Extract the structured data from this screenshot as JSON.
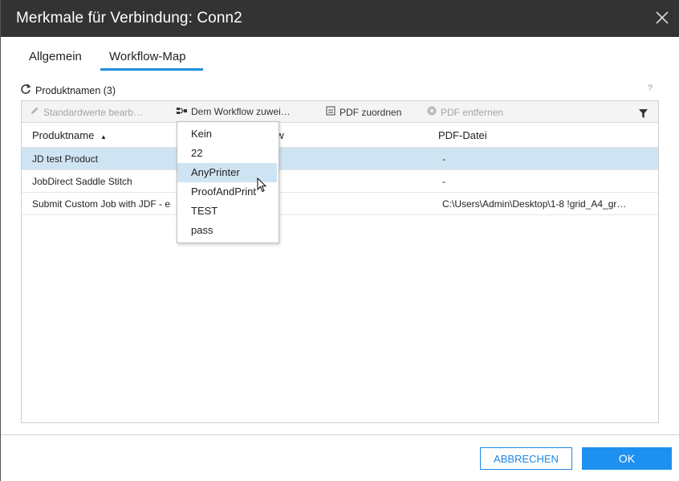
{
  "dialog": {
    "title": "Merkmale für Verbindung: Conn2",
    "close_icon": "close-icon"
  },
  "tabs": [
    {
      "label": "Allgemein",
      "active": false
    },
    {
      "label": "Workflow-Map",
      "active": true
    }
  ],
  "section": {
    "title": "Produktnamen (3)",
    "refresh_icon": "refresh-icon",
    "help": "?"
  },
  "toolbar": {
    "edit_defaults": "Standardwerte bearb…",
    "assign_workflow": "Dem Workflow zuwei…",
    "assign_pdf": "PDF zuordnen",
    "remove_pdf": "PDF entfernen",
    "filter_icon": "filter-icon"
  },
  "table": {
    "columns": [
      "Produktname",
      "Workflow",
      "PDF-Datei"
    ],
    "sort_indicator": "▲",
    "rows": [
      {
        "product": "JD test Product",
        "workflow": "",
        "pdf": "-",
        "selected": true
      },
      {
        "product": "JobDirect Saddle Stitch",
        "workflow": "",
        "pdf": "-",
        "selected": false
      },
      {
        "product": "Submit Custom Job with JDF - e",
        "workflow": "",
        "pdf": "C:\\Users\\Admin\\Desktop\\1-8 !grid_A4_gr…",
        "selected": false
      }
    ]
  },
  "workflow_header_visible": "kflow",
  "dropdown": {
    "items": [
      "Kein",
      "22",
      "AnyPrinter",
      "ProofAndPrint",
      "TEST",
      "pass"
    ],
    "hovered": "AnyPrinter"
  },
  "footer": {
    "cancel": "ABBRECHEN",
    "ok": "OK"
  },
  "colors": {
    "titlebar": "#333333",
    "accent": "#1e90f0",
    "selection": "#cfe4f3"
  }
}
